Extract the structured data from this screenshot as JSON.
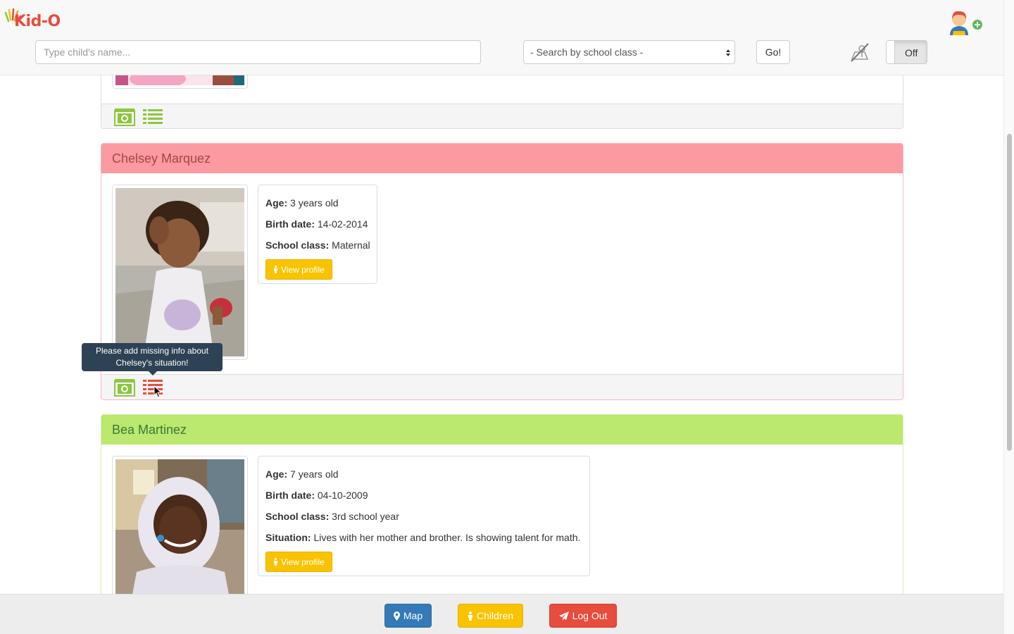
{
  "header": {
    "logo_text": "Kid-O",
    "search_placeholder": "Type child's name...",
    "class_select": "- Search by school class -",
    "go_label": "Go!",
    "toggle_label": "Off"
  },
  "children": [
    {
      "name": "Chelsey Marquez",
      "status": "incomplete",
      "age_label": "Age:",
      "age": "3 years old",
      "birth_label": "Birth date:",
      "birth": "14-02-2014",
      "class_label": "School class:",
      "class": "Maternal",
      "view_label": "View profile"
    },
    {
      "name": "Bea Martinez",
      "status": "complete",
      "age_label": "Age:",
      "age": "7 years old",
      "birth_label": "Birth date:",
      "birth": "04-10-2009",
      "class_label": "School class:",
      "class": "3rd school year",
      "situation_label": "Situation:",
      "situation": "Lives with her mother and brother. Is showing talent for math.",
      "view_label": "View profile"
    }
  ],
  "tooltip": {
    "line1": "Please add missing info about",
    "line2": "Chelsey's situation!"
  },
  "footer_nav": {
    "map": "Map",
    "children": "Children",
    "logout": "Log Out"
  },
  "colors": {
    "incomplete_heading": "#fc9aa2",
    "complete_heading": "#bbe86e",
    "view_button": "#f9c300",
    "map_button": "#337ab7",
    "logout_button": "#e74c3c"
  }
}
